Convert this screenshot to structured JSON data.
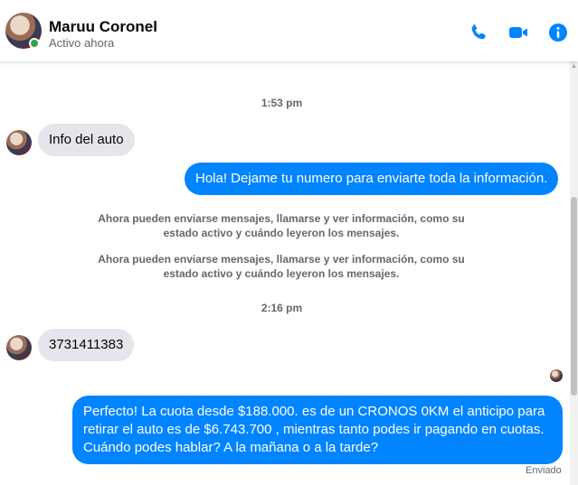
{
  "header": {
    "contact_name": "Maruu Coronel",
    "status": "Activo ahora",
    "online_color": "#31a24c",
    "accent_color": "#0084ff",
    "icons": [
      "phone-icon",
      "video-icon",
      "info-icon"
    ]
  },
  "messages": {
    "time_1": "1:53 pm",
    "in_1": "Info del auto",
    "out_1": "Hola! Dejame tu numero  para enviarte toda la información.",
    "system_1": "Ahora pueden enviarse mensajes, llamarse y ver información, como su estado activo y cuándo leyeron los mensajes.",
    "system_2": "Ahora pueden enviarse mensajes, llamarse y ver información, como su estado activo y cuándo leyeron los mensajes.",
    "time_2": "2:16 pm",
    "in_2": "3731411383",
    "out_2": "Perfecto! La cuota desde $188.000. es de un CRONOS 0KM el anticipo para retirar el auto es de $6.743.700 , mientras tanto podes ir pagando en cuotas. Cuándo podes hablar? A la mañana o a la tarde?",
    "delivery_status": "Enviado"
  }
}
